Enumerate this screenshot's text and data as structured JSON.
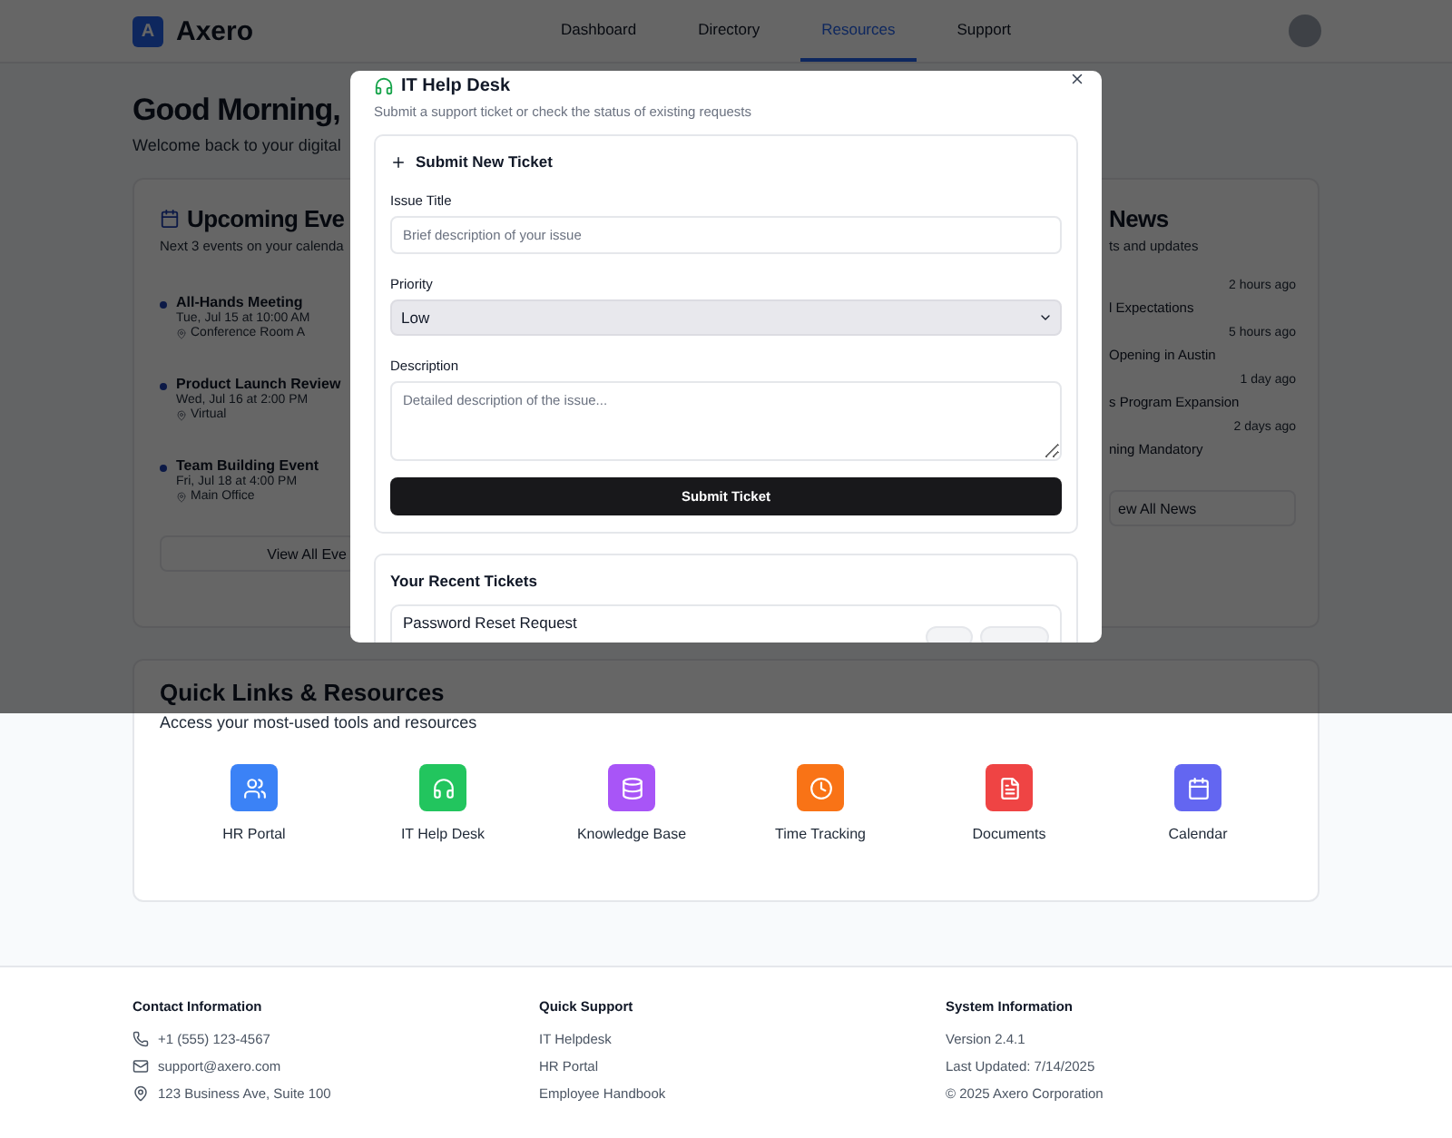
{
  "header": {
    "logo_letter": "A",
    "brand": "Axero",
    "nav": [
      {
        "label": "Dashboard",
        "selected": false
      },
      {
        "label": "Directory",
        "selected": false
      },
      {
        "label": "Resources",
        "selected": true
      },
      {
        "label": "Support",
        "selected": false
      }
    ]
  },
  "greeting": {
    "title": "Good Morning,",
    "subtitle": "Welcome back to your digital"
  },
  "events_card": {
    "title": "Upcoming Eve",
    "subtitle": "Next 3 events on your calenda",
    "events": [
      {
        "title": "All-Hands Meeting",
        "when": "Tue, Jul 15 at 10:00 AM",
        "location": "Conference Room A"
      },
      {
        "title": "Product Launch Review",
        "when": "Wed, Jul 16 at 2:00 PM",
        "location": "Virtual"
      },
      {
        "title": "Team Building Event",
        "when": "Fri, Jul 18 at 4:00 PM",
        "location": "Main Office"
      }
    ],
    "button": "View All Eve"
  },
  "news_card": {
    "title": "News",
    "subtitle": "ts and updates",
    "items": [
      {
        "time": "2 hours ago",
        "title": "l Expectations"
      },
      {
        "time": "5 hours ago",
        "title": "Opening in Austin"
      },
      {
        "time": "1 day ago",
        "title": "s Program Expansion"
      },
      {
        "time": "2 days ago",
        "title": "ning Mandatory"
      }
    ],
    "button": "ew All News"
  },
  "modal": {
    "title": "IT Help Desk",
    "subtitle": "Submit a support ticket or check the status of existing requests",
    "form": {
      "heading": "Submit New Ticket",
      "fields": [
        {
          "kind": "text",
          "label": "Issue Title",
          "placeholder": "Brief description of your issue"
        },
        {
          "kind": "select",
          "label": "Priority",
          "value": "Low"
        },
        {
          "kind": "textarea",
          "label": "Description",
          "placeholder": "Detailed description of the issue..."
        }
      ],
      "submit": "Submit Ticket"
    },
    "recent": {
      "title": "Your Recent Tickets",
      "tickets": [
        {
          "title": "Password Reset Request"
        }
      ]
    }
  },
  "quick_links": {
    "title": "Quick Links & Resources",
    "subtitle": "Access your most-used tools and resources",
    "links": [
      {
        "kind": "users",
        "label": "HR Portal",
        "color": "#3b82f6"
      },
      {
        "kind": "headphones",
        "label": "IT Help Desk",
        "color": "#22c55e"
      },
      {
        "kind": "database",
        "label": "Knowledge Base",
        "color": "#a855f7"
      },
      {
        "kind": "clock",
        "label": "Time Tracking",
        "color": "#f97316"
      },
      {
        "kind": "file",
        "label": "Documents",
        "color": "#ef4444"
      },
      {
        "kind": "calendar",
        "label": "Calendar",
        "color": "#6366f1"
      }
    ]
  },
  "footer": {
    "columns": [
      {
        "title": "Contact Information",
        "items": [
          {
            "kind": "phone",
            "text": "+1 (555) 123-4567"
          },
          {
            "kind": "mail",
            "text": "support@axero.com"
          },
          {
            "kind": "pin",
            "text": "123 Business Ave, Suite 100"
          }
        ]
      },
      {
        "title": "Quick Support",
        "items": [
          {
            "kind": "link",
            "text": "IT Helpdesk"
          },
          {
            "kind": "link",
            "text": "HR Portal"
          },
          {
            "kind": "link",
            "text": "Employee Handbook"
          }
        ]
      },
      {
        "title": "System Information",
        "items": [
          {
            "kind": "text",
            "text": "Version 2.4.1"
          },
          {
            "kind": "text",
            "text": "Last Updated: 7/14/2025"
          },
          {
            "kind": "text",
            "text": "© 2025 Axero Corporation"
          }
        ]
      }
    ]
  }
}
